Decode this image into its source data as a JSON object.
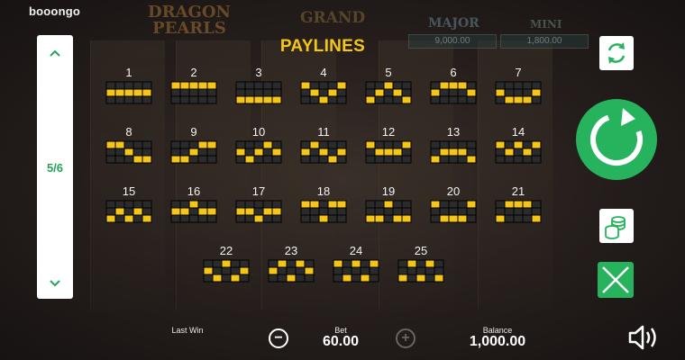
{
  "brand": "booongo",
  "game_logo": {
    "line1": "DRAGON",
    "line2": "PEARLS"
  },
  "jackpots": [
    {
      "label": "GRAND",
      "value": ""
    },
    {
      "label": "MAJOR",
      "value": "9,000.00"
    },
    {
      "label": "MINI",
      "value": "1,800.00"
    }
  ],
  "title": "PAYLINES",
  "pagination": {
    "current_label": "5/6",
    "up_icon": "chevron-up-icon",
    "down_icon": "chevron-down-icon"
  },
  "paylines": [
    {
      "id": "1",
      "pattern": [
        1,
        1,
        1,
        1,
        1
      ]
    },
    {
      "id": "2",
      "pattern": [
        0,
        0,
        0,
        0,
        0
      ]
    },
    {
      "id": "3",
      "pattern": [
        2,
        2,
        2,
        2,
        2
      ]
    },
    {
      "id": "4",
      "pattern": [
        0,
        1,
        2,
        1,
        0
      ]
    },
    {
      "id": "5",
      "pattern": [
        2,
        1,
        0,
        1,
        2
      ]
    },
    {
      "id": "6",
      "pattern": [
        1,
        0,
        0,
        0,
        1
      ]
    },
    {
      "id": "7",
      "pattern": [
        1,
        2,
        2,
        2,
        1
      ]
    },
    {
      "id": "8",
      "pattern": [
        0,
        0,
        1,
        2,
        2
      ]
    },
    {
      "id": "9",
      "pattern": [
        2,
        2,
        1,
        0,
        0
      ]
    },
    {
      "id": "10",
      "pattern": [
        1,
        2,
        1,
        0,
        1
      ]
    },
    {
      "id": "11",
      "pattern": [
        1,
        0,
        1,
        2,
        1
      ]
    },
    {
      "id": "12",
      "pattern": [
        0,
        1,
        1,
        1,
        0
      ]
    },
    {
      "id": "13",
      "pattern": [
        2,
        1,
        1,
        1,
        2
      ]
    },
    {
      "id": "14",
      "pattern": [
        0,
        1,
        0,
        1,
        0
      ]
    },
    {
      "id": "15",
      "pattern": [
        2,
        1,
        2,
        1,
        2
      ]
    },
    {
      "id": "16",
      "pattern": [
        1,
        1,
        0,
        1,
        1
      ]
    },
    {
      "id": "17",
      "pattern": [
        1,
        1,
        2,
        1,
        1
      ]
    },
    {
      "id": "18",
      "pattern": [
        0,
        0,
        2,
        0,
        0
      ]
    },
    {
      "id": "19",
      "pattern": [
        2,
        2,
        0,
        2,
        2
      ]
    },
    {
      "id": "20",
      "pattern": [
        0,
        2,
        2,
        2,
        0
      ]
    },
    {
      "id": "21",
      "pattern": [
        2,
        0,
        0,
        0,
        2
      ]
    },
    {
      "id": "22",
      "pattern": [
        1,
        2,
        0,
        2,
        1
      ]
    },
    {
      "id": "23",
      "pattern": [
        1,
        0,
        2,
        0,
        1
      ]
    },
    {
      "id": "24",
      "pattern": [
        0,
        2,
        0,
        2,
        0
      ]
    },
    {
      "id": "25",
      "pattern": [
        2,
        0,
        2,
        0,
        2
      ]
    }
  ],
  "colors": {
    "accent_green": "#27b35e",
    "line_yellow": "#f5c518",
    "grid_dark": "#2b2b2b"
  },
  "controls": {
    "autoplay_icon": "autoplay-refresh-icon",
    "spin_icon": "spin-arrow-icon",
    "bet_icon": "coin-stack-icon",
    "close_icon": "close-x-icon",
    "sound_icon": "speaker-icon"
  },
  "footer": {
    "last_win_label": "Last Win",
    "last_win_value": "",
    "bet_label": "Bet",
    "bet_value": "60.00",
    "balance_label": "Balance",
    "balance_value": "1,000.00",
    "minus_symbol": "−",
    "plus_symbol": "+"
  }
}
